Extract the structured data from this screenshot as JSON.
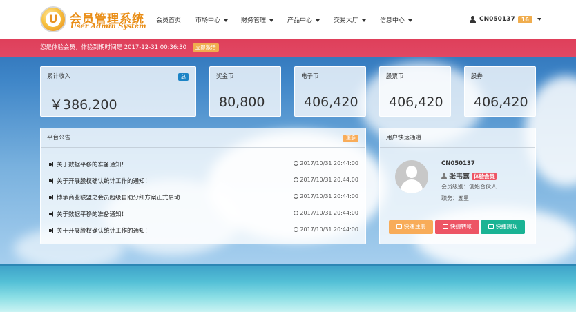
{
  "brand": {
    "logo_letter": "U",
    "name_cn": "会员管理系统",
    "name_en": "User Admin System"
  },
  "nav": {
    "items": [
      "会员首页",
      "市场中心",
      "财务管理",
      "产品中心",
      "交易大厅",
      "信息中心"
    ],
    "user_id": "CN050137",
    "count": "16"
  },
  "notice": {
    "text": "您是体验会员，体验到期时间是 2017-12-31 00:36:30",
    "activate_label": "立即激活"
  },
  "stats": [
    {
      "label": "累计收入",
      "value": "￥386,200",
      "badge": "总"
    },
    {
      "label": "奖金币",
      "value": "80,800"
    },
    {
      "label": "电子币",
      "value": "406,420"
    },
    {
      "label": "股票币",
      "value": "406,420"
    },
    {
      "label": "股券",
      "value": "406,420"
    }
  ],
  "announcements": {
    "title": "平台公告",
    "more_label": "更多",
    "items": [
      {
        "title": "关于数据平移的准备通知！",
        "time": "2017/10/31 20:44:00"
      },
      {
        "title": "关于开展股权确认统计工作的通知！",
        "time": "2017/10/31 20:44:00"
      },
      {
        "title": "博承商业联盟之会员超级自助分红方案正式启动",
        "time": "2017/10/31 20:44:00"
      },
      {
        "title": "关于数据平移的准备通知！",
        "time": "2017/10/31 20:44:00"
      },
      {
        "title": "关于开展股权确认统计工作的通知！",
        "time": "2017/10/31 20:44:00"
      }
    ]
  },
  "quick": {
    "title": "用户快速通道",
    "user_id": "CN050137",
    "name": "张韦嘉",
    "member_badge": "体验会员",
    "level": "会员级别：创始合伙人",
    "post": "职务：五星",
    "buttons": [
      "快速注册",
      "快捷转帐",
      "快捷提现"
    ]
  },
  "colors": {
    "accent_orange": "#f0ad4e",
    "notice_red": "#df3f5a",
    "btn_red": "#ed5565",
    "btn_green": "#1ab394",
    "badge_blue": "#1c84c6"
  }
}
